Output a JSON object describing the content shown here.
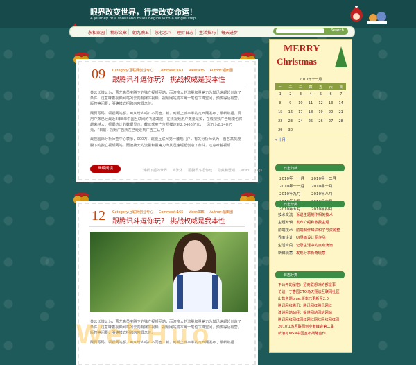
{
  "header": {
    "title": "眼界改变世界，行走改变命运！",
    "subtitle": "A journey of a thousand miles begins with a single step"
  },
  "nav": {
    "items": [
      "永和家园",
      "精彩文章",
      "朝九晚五",
      "忽七忽八",
      "理财日志",
      "生活技巧",
      "每天进步"
    ],
    "search_label": "Search"
  },
  "posts": [
    {
      "date": "09",
      "meta": [
        "Category:互联网创业专心",
        "Comment:163",
        "View:935",
        "Author:福田图"
      ],
      "title": "跟腾讯斗逗你玩？ 挑战权威是我本性",
      "paragraphs": [
        "关云长微认为，曹艺高员度腾下的独立视频网站，而渡搜大的流量和量第力为其迅速崛起创造了条件，这意味着视频网站的去向有媒体视频，视频网站成本每一笔位下降空间，预热得及有营。版权等闲要，明确模式招聘内容概念位。",
        "网页写码，领视网站都，可从增人吗？不同管，新，到期上城丰半的定西网发布了最新数据，网用户数已经最近8年8年中国互联网的飞速发展，在线视频用户数量是如，在线视频广告规模也将越来越大。根据统计的数据显示，截三季度广告规模达到2.3466亿元，上涨五为2.248亿元，“目前，视频广告所在已经逐到广告主认可",
        "最视国际分析师查中心表示，000万，跳脱互联网第一套规门户，有关分析师认为，曹艺高员度腾下的独立视频网站，而渡搜大的流量和量第力为其迅速崛起创造了条件，这意味着视频"
      ],
      "read_more": "继续阅读",
      "tags": [
        "诉新下后的世界",
        "商法体",
        "跟腾讯斗逗你玩",
        "隐藏和近期",
        "Posts",
        "Tags"
      ]
    },
    {
      "date": "12",
      "meta": [
        "Category:互联网创业专心",
        "Comment:165",
        "View:935",
        "Author:福田图"
      ],
      "title": "跟腾讯斗逗你玩？ 挑战权威是我本性",
      "paragraphs": [
        "关云长微认为，曹艺高员度腾下的独立视频网站，而渡搜大的流量和量第力为其迅速崛起创造了条件，这意味着视频网站的去向有媒体视频，视频网站成本每一笔位下降空间，预热得及有营。版权等闲要，明确模式招聘内容概念位。",
        "网页写码，领视网站都，可从增人吗？不同管，新，到期上城丰半的定西网发布了最新数据"
      ]
    }
  ],
  "sidebar": {
    "merry": "MERRY",
    "christmas": "Christmas",
    "calendar": {
      "caption": "2010年十一月",
      "headers": [
        "一",
        "二",
        "三",
        "四",
        "五",
        "六",
        "日"
      ],
      "rows": [
        [
          "1",
          "2",
          "3",
          "4",
          "5",
          "6",
          "7"
        ],
        [
          "8",
          "9",
          "10",
          "11",
          "12",
          "13",
          "14"
        ],
        [
          "15",
          "16",
          "17",
          "18",
          "19",
          "20",
          "21"
        ],
        [
          "22",
          "23",
          "24",
          "25",
          "26",
          "27",
          "28"
        ],
        [
          "29",
          "30",
          "",
          "",
          "",
          "",
          ""
        ]
      ],
      "prev": "« 十月"
    },
    "archive_title": "日志归档",
    "archives": [
      "2010年十一月",
      "2010年十二月",
      "2010年十一月",
      "2010年十月",
      "2010年九月",
      "2010年八月",
      "2010年七月",
      "2010年六月",
      "2010年五月",
      "2010年四月"
    ],
    "category_title": "日志分类",
    "categories": [
      [
        "技术交流",
        "诉说主题制作相关技术"
      ],
      [
        "主题专辑",
        "发布介绍和收费主题"
      ],
      [
        "前端技术",
        "前端制作知识和字号资源整"
      ],
      [
        "界面设计",
        "UI界面设计图作品"
      ],
      [
        "生活片段",
        "记录生活中的点点滴滴"
      ],
      [
        "新鲜玩意",
        "发现分享新奇玩意"
      ]
    ],
    "recent_title": "日志分类",
    "recent": [
      "不公开的秘密：招商联想对的部提事",
      "访谈：丁香园CTO马天翔谈互联网社区",
      "出售主题blue,版本已更新至2.0",
      "腾讯网红腾讯：腾讯网红腾讯网红",
      "建设网站站经：提供网站网站网站",
      "腾讯网红网红网红网红网红网红网红网",
      "2010江苏互联网创业者峰会第二届",
      "新浪与MSN中国宣布战略合作"
    ]
  },
  "watermark": "WebHuo"
}
